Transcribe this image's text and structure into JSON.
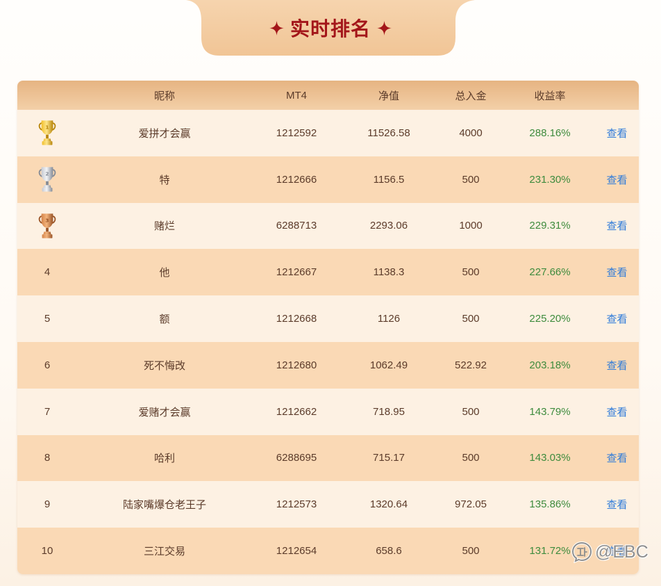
{
  "title": {
    "text": "实时排名",
    "icon": "sparkle-icon",
    "color": "#a3161a"
  },
  "table": {
    "headers": {
      "nickname": "昵称",
      "mt4": "MT4",
      "net_value": "净值",
      "total_deposit": "总入金",
      "return_rate": "收益率"
    },
    "rows": [
      {
        "rank": "1",
        "trophy": "gold",
        "nickname": "爱拼才会赢",
        "mt4": "1212592",
        "net_value": "11526.58",
        "total_deposit": "4000",
        "return_rate": "288.16%",
        "action": "查看"
      },
      {
        "rank": "2",
        "trophy": "silver",
        "nickname": "特",
        "mt4": "1212666",
        "net_value": "1156.5",
        "total_deposit": "500",
        "return_rate": "231.30%",
        "action": "查看"
      },
      {
        "rank": "3",
        "trophy": "bronze",
        "nickname": "赌烂",
        "mt4": "6288713",
        "net_value": "2293.06",
        "total_deposit": "1000",
        "return_rate": "229.31%",
        "action": "查看"
      },
      {
        "rank": "4",
        "nickname": "他",
        "mt4": "1212667",
        "net_value": "1138.3",
        "total_deposit": "500",
        "return_rate": "227.66%",
        "action": "查看"
      },
      {
        "rank": "5",
        "nickname": "额",
        "mt4": "1212668",
        "net_value": "1126",
        "total_deposit": "500",
        "return_rate": "225.20%",
        "action": "查看"
      },
      {
        "rank": "6",
        "nickname": "死不悔改",
        "mt4": "1212680",
        "net_value": "1062.49",
        "total_deposit": "522.92",
        "return_rate": "203.18%",
        "action": "查看"
      },
      {
        "rank": "7",
        "nickname": "爱赌才会赢",
        "mt4": "1212662",
        "net_value": "718.95",
        "total_deposit": "500",
        "return_rate": "143.79%",
        "action": "查看"
      },
      {
        "rank": "8",
        "nickname": "哈利",
        "mt4": "6288695",
        "net_value": "715.17",
        "total_deposit": "500",
        "return_rate": "143.03%",
        "action": "查看"
      },
      {
        "rank": "9",
        "nickname": "陆家嘴爆仓老王子",
        "mt4": "1212573",
        "net_value": "1320.64",
        "total_deposit": "972.05",
        "return_rate": "135.86%",
        "action": "查看"
      },
      {
        "rank": "10",
        "nickname": "三江交易",
        "mt4": "1212654",
        "net_value": "658.6",
        "total_deposit": "500",
        "return_rate": "131.72%",
        "action": "查看"
      }
    ]
  },
  "colors": {
    "header_bg": "#ecc092",
    "row_light": "#fdf1e3",
    "row_dark": "#fad9b5",
    "text": "#5b3b2a",
    "return_rate": "#3d8b3d",
    "link": "#2f7bd9"
  },
  "trophy_colors": {
    "gold": {
      "light": "#fde58a",
      "mid": "#f1bf2c",
      "dark": "#b8860b"
    },
    "silver": {
      "light": "#f2f3f6",
      "mid": "#c6cad2",
      "dark": "#848b96"
    },
    "bronze": {
      "light": "#f3b37c",
      "mid": "#d4844a",
      "dark": "#9a5427"
    }
  },
  "watermark": {
    "text": "@EBC",
    "icon": "zhihu-logo-icon"
  }
}
